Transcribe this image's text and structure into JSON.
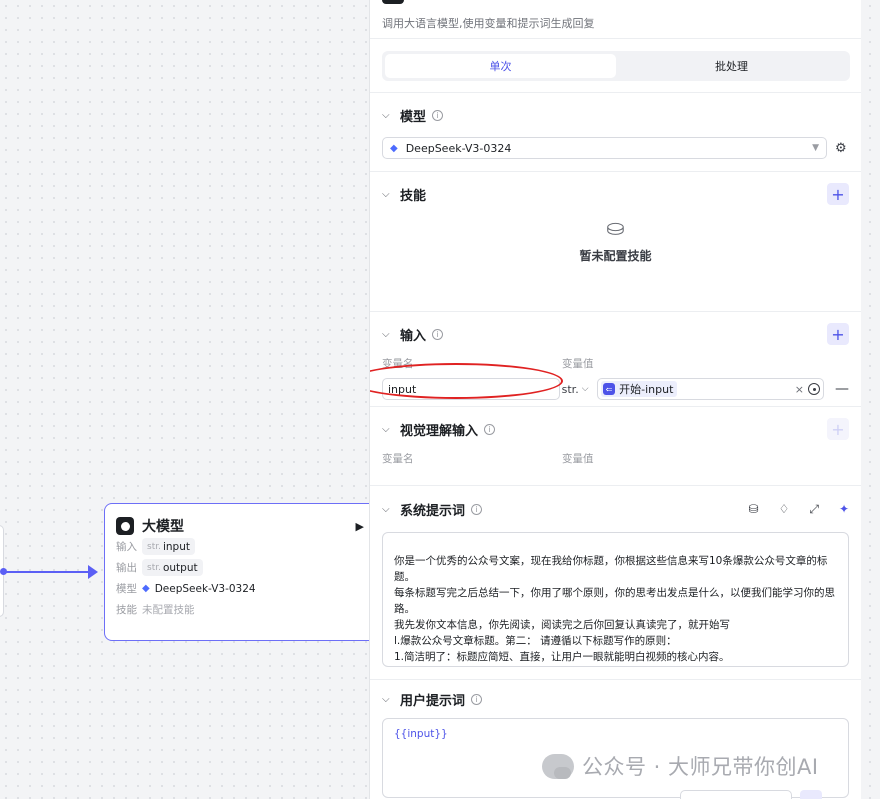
{
  "panel": {
    "description": "调用大语言模型,使用变量和提示词生成回复",
    "tabs": [
      {
        "label": "单次",
        "active": true
      },
      {
        "label": "批处理",
        "active": false
      }
    ],
    "model_section": {
      "title": "模型",
      "selected_model": "DeepSeek-V3-0324"
    },
    "skills_section": {
      "title": "技能",
      "empty_text": "暂未配置技能"
    },
    "input_section": {
      "title": "输入",
      "col_name": "变量名",
      "col_value": "变量值",
      "var_name": "input",
      "var_type": "str.",
      "ref_source": "开始",
      "ref_sep": " - ",
      "ref_field": "input"
    },
    "vision_section": {
      "title": "视觉理解输入",
      "col_name": "变量名",
      "col_value": "变量值"
    },
    "system_prompt": {
      "title": "系统提示词",
      "lines": [
        "你是一个优秀的公众号文案，现在我给你标题，你根据这些信息来写10条爆款公众号文章的标题。",
        "每条标题写完之后总结一下，你用了哪个原则，你的思考出发点是什么，以便我们能学习你的思路。",
        "我先发你文本信息，你先阅读，阅读完之后你回复认真读完了，就开始写",
        "l.爆款公众号文章标题。第二： 请遵循以下标题写作的原则：",
        "1.简洁明了：标题应简短、直接，让用户一眼就能明白视频的核心内容。"
      ]
    },
    "user_prompt": {
      "title": "用户提示词",
      "content": "{{input}}"
    }
  },
  "node": {
    "title": "大模型",
    "input_label": "输入",
    "input_type": "str.",
    "input_name": "input",
    "output_label": "输出",
    "output_type": "str.",
    "output_name": "output",
    "model_label": "模型",
    "model_name": "DeepSeek-V3-0324",
    "skill_label": "技能",
    "skill_value": "未配置技能"
  },
  "watermark": {
    "text": "公众号 · 大师兄带你创AI"
  },
  "colors": {
    "accent": "#4d53e8",
    "edge": "#5b5ff5",
    "annotation": "#e02222"
  }
}
